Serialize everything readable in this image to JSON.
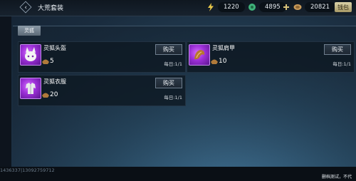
{
  "header": {
    "title": "大荒套装",
    "back_icon": "back-arrow-icon",
    "resources": [
      {
        "name": "lightning",
        "icon": "lightning-icon",
        "value": "1220",
        "color": "#e9c94a"
      },
      {
        "name": "jade",
        "icon": "jade-icon",
        "value": "4895",
        "color": "#3fb37a"
      },
      {
        "name": "coin",
        "icon": "coin-icon",
        "value": "20821",
        "color": "#c89a5a"
      }
    ],
    "charge_label": "钱包"
  },
  "tabs": [
    {
      "label": "灵狐",
      "active": true
    }
  ],
  "items": [
    {
      "name": "灵狐头盔",
      "price": "5",
      "buy_label": "购买",
      "limit": "每日:1/1",
      "currency_icon": "ingot-icon"
    },
    {
      "name": "灵狐肩甲",
      "price": "10",
      "buy_label": "购买",
      "limit": "每日:1/1",
      "currency_icon": "ingot-icon"
    },
    {
      "name": "灵狐衣服",
      "price": "20",
      "buy_label": "购买",
      "limit": "每日:1/1",
      "currency_icon": "ingot-icon"
    }
  ],
  "footer": {
    "uid": "1436337|13092759712",
    "note": "删档测试，不代"
  }
}
